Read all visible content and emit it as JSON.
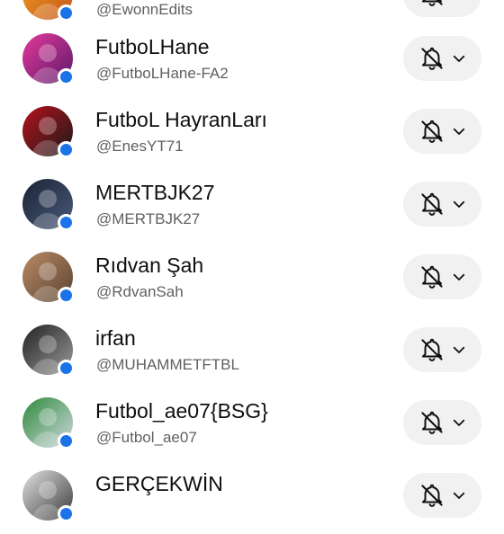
{
  "subscriptions": [
    {
      "name": "",
      "handle": "@EwonnEdits",
      "avatar_colors": [
        "#f4a01f",
        "#c2551a"
      ],
      "partial": "top"
    },
    {
      "name": "FutboLHane",
      "handle": "@FutboLHane-FA2",
      "avatar_colors": [
        "#e6399b",
        "#5a1a6a"
      ]
    },
    {
      "name": "FutboL HayranLarı",
      "handle": "@EnesYT71",
      "avatar_colors": [
        "#b5121b",
        "#1b1b1b"
      ]
    },
    {
      "name": "MERTBJK27",
      "handle": "@MERTBJK27",
      "avatar_colors": [
        "#1b2436",
        "#4a5a7a"
      ]
    },
    {
      "name": "Rıdvan Şah",
      "handle": "@RdvanSah",
      "avatar_colors": [
        "#b98a66",
        "#5b4331"
      ]
    },
    {
      "name": "irfan",
      "handle": "@MUHAMMETFTBL",
      "avatar_colors": [
        "#222222",
        "#9a9a9a"
      ]
    },
    {
      "name": "Futbol_ae07{BSG}",
      "handle": "@Futbol_ae07",
      "avatar_colors": [
        "#2e8a3a",
        "#cfd8e0"
      ]
    },
    {
      "name": "GERÇEKWİN",
      "handle": "",
      "avatar_colors": [
        "#e2e2e2",
        "#3a3a3a"
      ],
      "partial": "bottom"
    }
  ],
  "icons": {
    "notification": "bell-off-icon",
    "dropdown": "chevron-down-icon",
    "live_indicator": "blue-dot"
  },
  "colors": {
    "live_dot": "#1a73e8",
    "button_bg": "#f1f1f1",
    "name_text": "#0f0f0f",
    "handle_text": "#606060"
  }
}
